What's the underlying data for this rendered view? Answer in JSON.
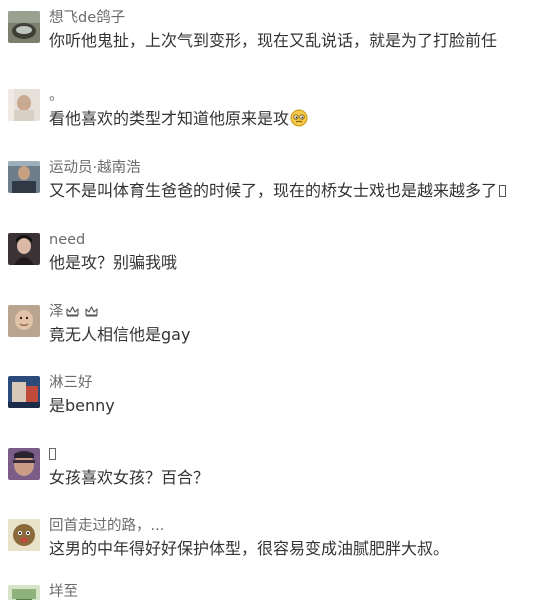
{
  "comments": [
    {
      "username": "想飞de鸽子",
      "text": "你听他鬼扯，上次气到变形，现在又乱说话，就是为了打脸前任"
    },
    {
      "username": "。",
      "text": "看他喜欢的类型才知道他原来是攻"
    },
    {
      "username": "运动员·越南浩",
      "text": "又不是叫体育生爸爸的时候了，现在的桥女士戏也是越来越多了"
    },
    {
      "username": "need",
      "text": "他是攻？别骗我哦"
    },
    {
      "username": "泽",
      "text": "竟无人相信他是gay"
    },
    {
      "username": "淋三好",
      "text": "是benny"
    },
    {
      "username": "",
      "text": "女孩喜欢女孩？百合？"
    },
    {
      "username": "回首走过的路，...",
      "text": "这男的中年得好好保护体型，很容易变成油腻肥胖大叔。"
    },
    {
      "username": "垟至",
      "text": ""
    }
  ],
  "icons": {
    "emoji": "thinking-face-icon",
    "badge": "crown-icon",
    "missing": "missing-glyph-icon"
  }
}
